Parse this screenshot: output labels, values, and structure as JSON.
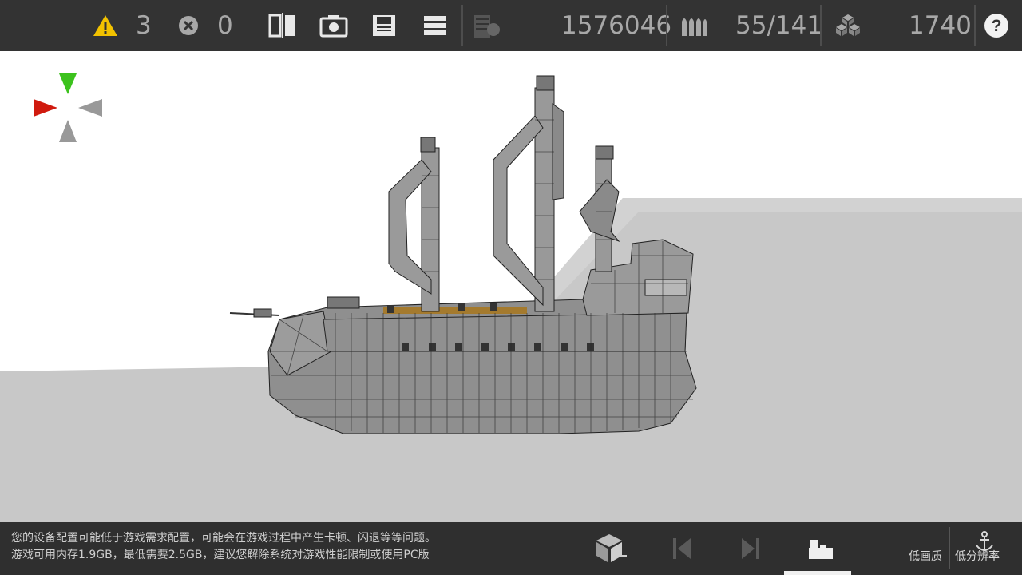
{
  "topbar": {
    "warnings_count": "3",
    "errors_count": "0",
    "cost": "1576046",
    "ammo": "55/141",
    "blocks": "1740"
  },
  "notice": {
    "line1": "您的设备配置可能低于游戏需求配置，可能会在游戏过程中产生卡顿、闪退等等问题。",
    "line2": "游戏可用内存1.9GB，最低需要2.5GB，建议您解除系统对游戏性能限制或使用PC版"
  },
  "bottom": {
    "low_quality": "低画质",
    "low_resolution": "低分辨率"
  },
  "colors": {
    "topbar_bg": "#333333",
    "warning_yellow": "#f2c200",
    "axis_green": "#3cc21d",
    "axis_red": "#d01a0e",
    "axis_gray": "#999999",
    "ground_gray": "#c8c8c8"
  },
  "icons": [
    "warning-icon",
    "error-icon",
    "mirror-icon",
    "screenshot-icon",
    "save-icon",
    "menu-icon",
    "cost-icon",
    "ammo-icon",
    "blocks-icon",
    "help-icon",
    "build-cube-icon",
    "prev-icon",
    "next-icon",
    "vehicle-icon",
    "anchor-icon"
  ]
}
